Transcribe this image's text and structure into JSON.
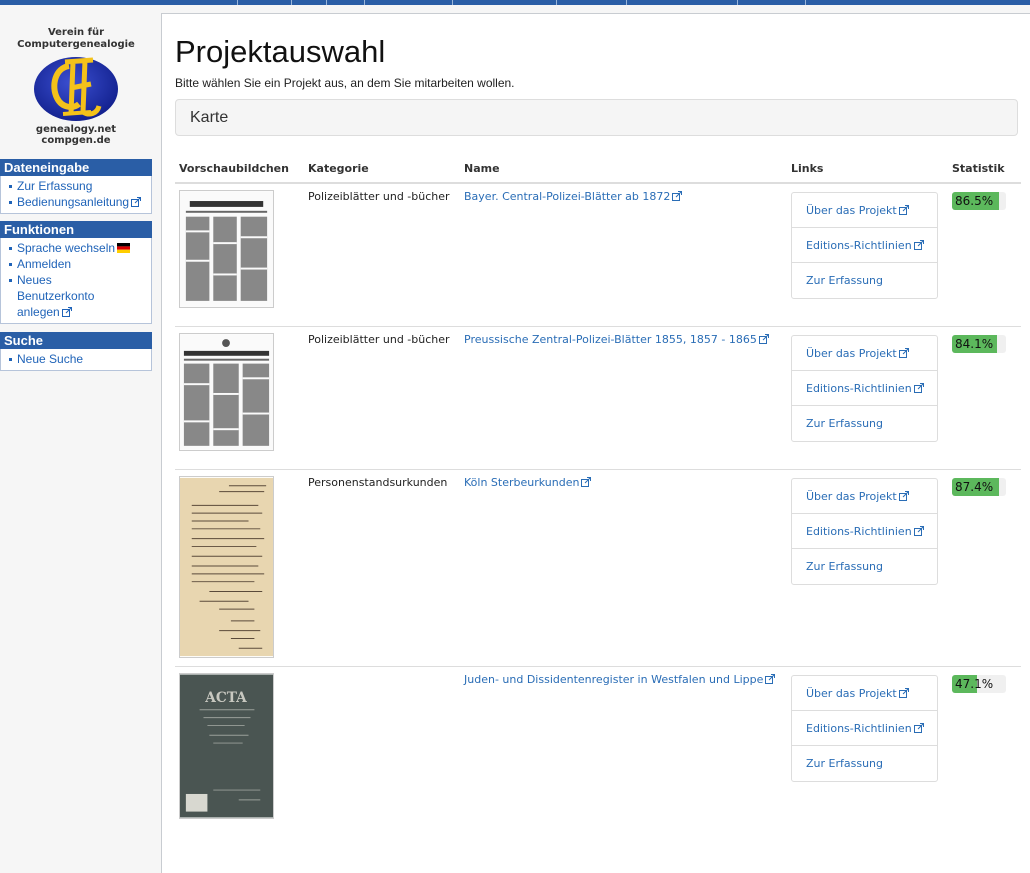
{
  "sidebar": {
    "logo": {
      "line1": "Verein für",
      "line2": "Computergenealogie",
      "site1": "genealogy.net",
      "site2": "compgen.de"
    },
    "portlets": [
      {
        "title": "Dateneingabe",
        "items": [
          "Zur Erfassung",
          "Bedienungsanleitung"
        ]
      },
      {
        "title": "Funktionen",
        "items": [
          "Sprache wechseln",
          "Anmelden",
          "Neues",
          "Benutzerkonto",
          "anlegen"
        ]
      },
      {
        "title": "Suche",
        "items": [
          "Neue Suche"
        ]
      }
    ]
  },
  "main": {
    "title": "Projektauswahl",
    "intro": "Bitte wählen Sie ein Projekt aus, an dem Sie mitarbeiten wollen.",
    "map_panel": "Karte",
    "table": {
      "headers": [
        "Vorschaubildchen",
        "Kategorie",
        "Name",
        "Links",
        "Statistik"
      ],
      "rows": [
        {
          "category": "Polizeiblätter und -bücher",
          "name": "Bayer. Central-Polizei-Blätter ab 1872",
          "links": [
            "Über das Projekt",
            "Editions-Richtlinien",
            "Zur Erfassung"
          ],
          "stat_label": "86.5%",
          "stat_value": 86.5
        },
        {
          "category": "Polizeiblätter und -bücher",
          "name": "Preussische Zentral-Polizei-Blätter 1855, 1857 - 1865",
          "links": [
            "Über das Projekt",
            "Editions-Richtlinien",
            "Zur Erfassung"
          ],
          "stat_label": "84.1%",
          "stat_value": 84.1
        },
        {
          "category": "Personenstandsurkunden",
          "name": "Köln Sterbeurkunden",
          "links": [
            "Über das Projekt",
            "Editions-Richtlinien",
            "Zur Erfassung"
          ],
          "stat_label": "87.4%",
          "stat_value": 87.4
        },
        {
          "category": "",
          "name": "Juden- und Dissidentenregister in Westfalen und Lippe",
          "links": [
            "Über das Projekt",
            "Editions-Richtlinien",
            "Zur Erfassung"
          ],
          "stat_label": "47.1%",
          "stat_value": 47.1
        }
      ]
    }
  },
  "colors": {
    "accent": "#2a5ea6",
    "link": "#2a6db6",
    "progress": "#5cb85c"
  },
  "icons": [
    "external-link-icon",
    "german-flag-icon"
  ]
}
